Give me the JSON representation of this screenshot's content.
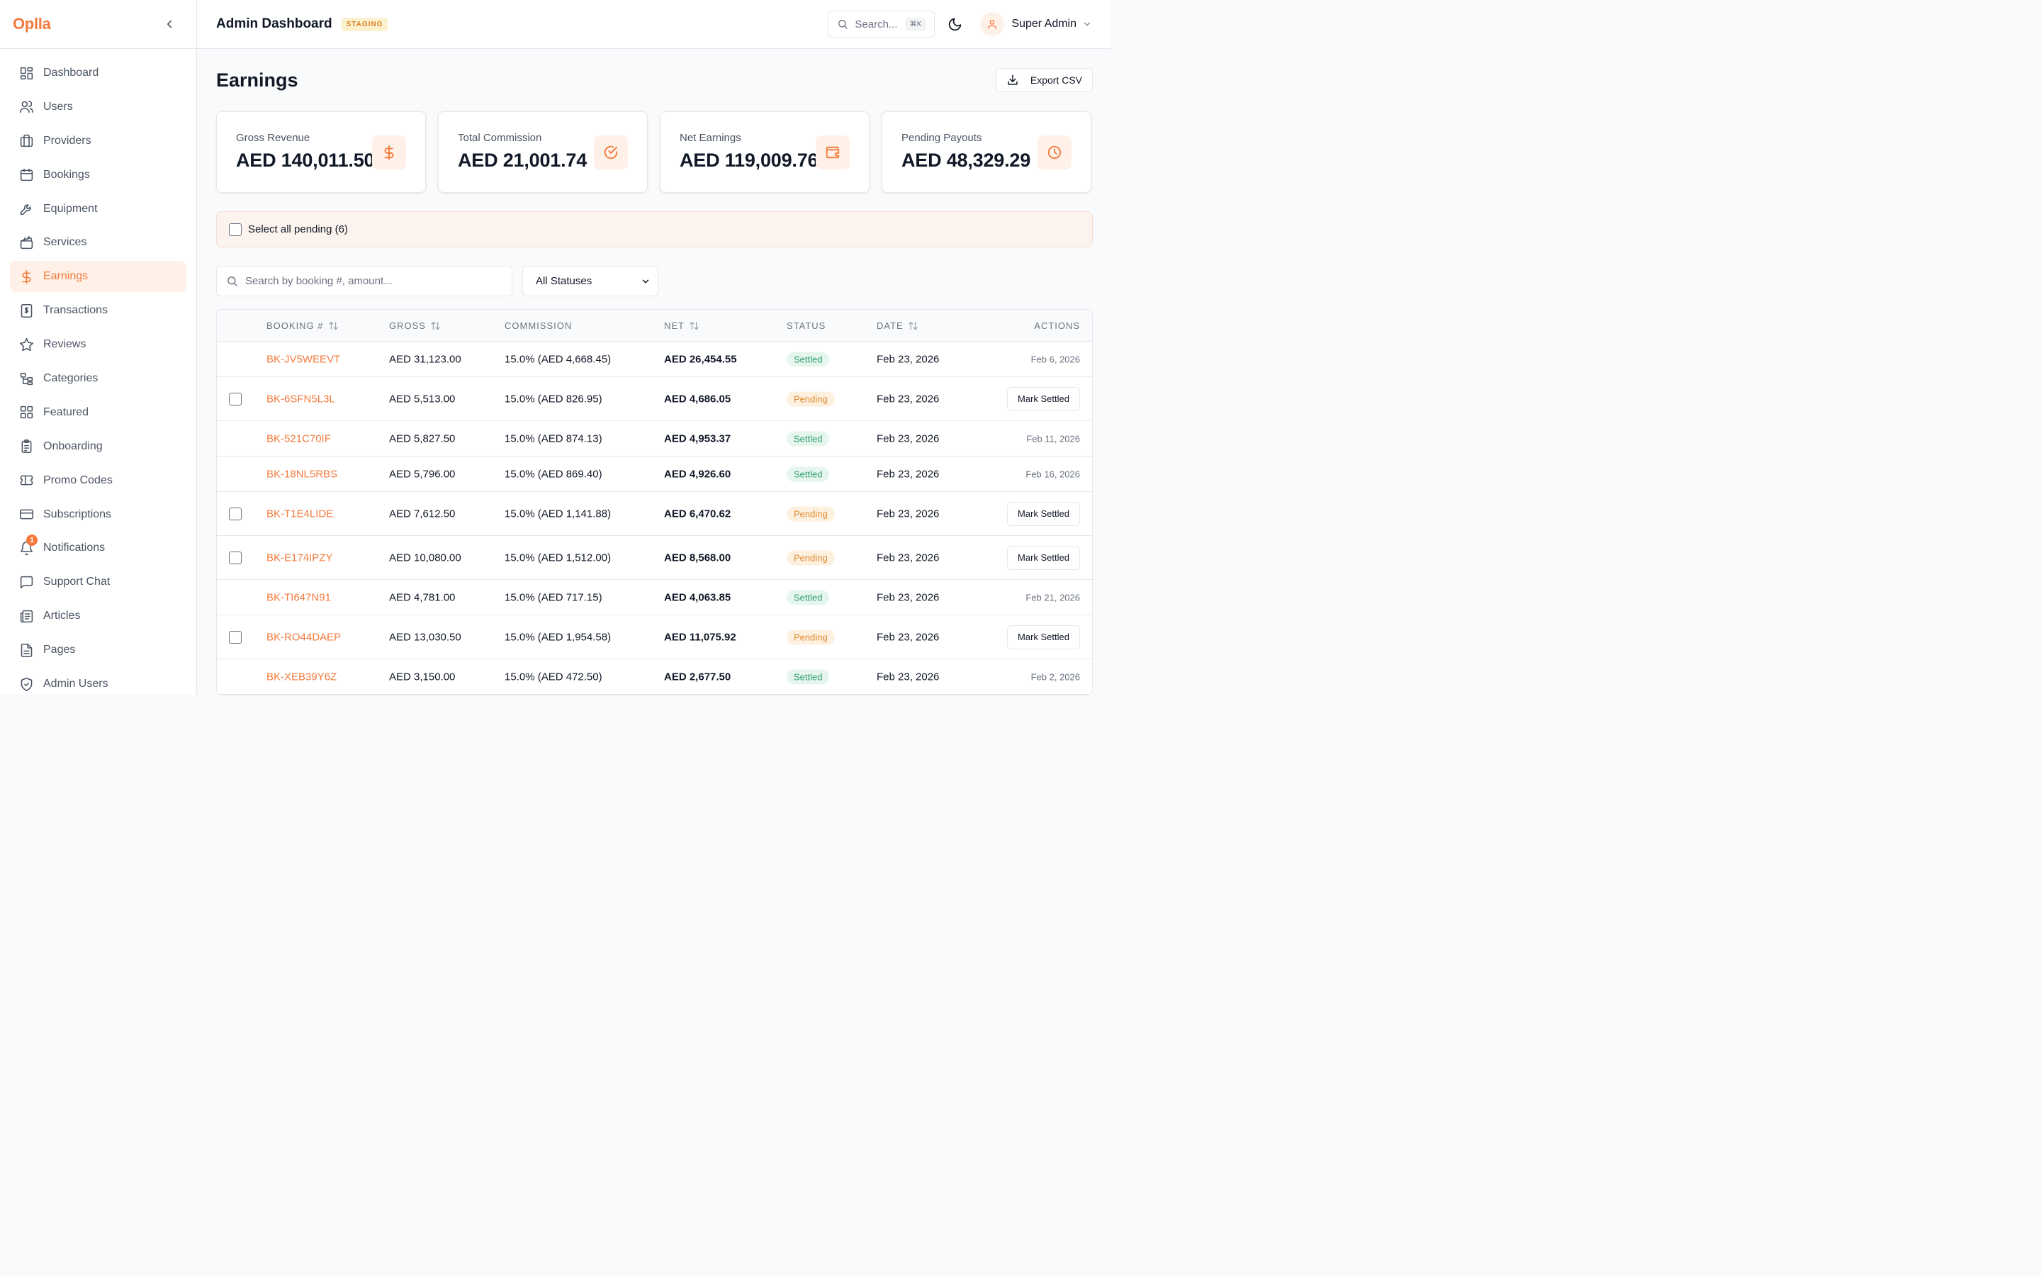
{
  "brand": "Oplla",
  "sidebar": {
    "items": [
      {
        "label": "Dashboard"
      },
      {
        "label": "Users"
      },
      {
        "label": "Providers"
      },
      {
        "label": "Bookings"
      },
      {
        "label": "Equipment"
      },
      {
        "label": "Services"
      },
      {
        "label": "Earnings"
      },
      {
        "label": "Transactions"
      },
      {
        "label": "Reviews"
      },
      {
        "label": "Categories"
      },
      {
        "label": "Featured"
      },
      {
        "label": "Onboarding"
      },
      {
        "label": "Promo Codes"
      },
      {
        "label": "Subscriptions"
      },
      {
        "label": "Notifications",
        "badge": "1"
      },
      {
        "label": "Support Chat"
      },
      {
        "label": "Articles"
      },
      {
        "label": "Pages"
      },
      {
        "label": "Admin Users"
      }
    ],
    "active": "Earnings"
  },
  "header": {
    "title": "Admin Dashboard",
    "env_badge": "STAGING",
    "search_placeholder": "Search...",
    "search_shortcut": "⌘K",
    "user_name": "Super Admin"
  },
  "page": {
    "title": "Earnings",
    "export_label": "Export CSV"
  },
  "stats": [
    {
      "label": "Gross Revenue",
      "value": "AED 140,011.50",
      "icon": "dollar-icon"
    },
    {
      "label": "Total Commission",
      "value": "AED 21,001.74",
      "icon": "check-circle-icon"
    },
    {
      "label": "Net Earnings",
      "value": "AED 119,009.76",
      "icon": "wallet-icon"
    },
    {
      "label": "Pending Payouts",
      "value": "AED 48,329.29",
      "icon": "clock-icon"
    }
  ],
  "select_all": "Select all pending (6)",
  "filters": {
    "search_placeholder": "Search by booking #, amount...",
    "status_selected": "All Statuses"
  },
  "table": {
    "columns": {
      "booking": "BOOKING #",
      "gross": "GROSS",
      "commission": "COMMISSION",
      "net": "NET",
      "status": "STATUS",
      "date": "DATE",
      "actions": "ACTIONS"
    },
    "mark_settled_label": "Mark Settled",
    "rows": [
      {
        "booking": "BK-JV5WEEVT",
        "gross": "AED 31,123.00",
        "commission": "15.0% (AED 4,668.45)",
        "net": "AED 26,454.55",
        "status": "Settled",
        "date": "Feb 23, 2026",
        "settled_date": "Feb 6, 2026"
      },
      {
        "booking": "BK-6SFN5L3L",
        "gross": "AED 5,513.00",
        "commission": "15.0% (AED 826.95)",
        "net": "AED 4,686.05",
        "status": "Pending",
        "date": "Feb 23, 2026"
      },
      {
        "booking": "BK-521C70IF",
        "gross": "AED 5,827.50",
        "commission": "15.0% (AED 874.13)",
        "net": "AED 4,953.37",
        "status": "Settled",
        "date": "Feb 23, 2026",
        "settled_date": "Feb 11, 2026"
      },
      {
        "booking": "BK-18NL5RBS",
        "gross": "AED 5,796.00",
        "commission": "15.0% (AED 869.40)",
        "net": "AED 4,926.60",
        "status": "Settled",
        "date": "Feb 23, 2026",
        "settled_date": "Feb 16, 2026"
      },
      {
        "booking": "BK-T1E4LIDE",
        "gross": "AED 7,612.50",
        "commission": "15.0% (AED 1,141.88)",
        "net": "AED 6,470.62",
        "status": "Pending",
        "date": "Feb 23, 2026"
      },
      {
        "booking": "BK-E174IPZY",
        "gross": "AED 10,080.00",
        "commission": "15.0% (AED 1,512.00)",
        "net": "AED 8,568.00",
        "status": "Pending",
        "date": "Feb 23, 2026"
      },
      {
        "booking": "BK-TI647N91",
        "gross": "AED 4,781.00",
        "commission": "15.0% (AED 717.15)",
        "net": "AED 4,063.85",
        "status": "Settled",
        "date": "Feb 23, 2026",
        "settled_date": "Feb 21, 2026"
      },
      {
        "booking": "BK-RO44DAEP",
        "gross": "AED 13,030.50",
        "commission": "15.0% (AED 1,954.58)",
        "net": "AED 11,075.92",
        "status": "Pending",
        "date": "Feb 23, 2026"
      },
      {
        "booking": "BK-XEB39Y6Z",
        "gross": "AED 3,150.00",
        "commission": "15.0% (AED 472.50)",
        "net": "AED 2,677.50",
        "status": "Settled",
        "date": "Feb 23, 2026",
        "settled_date": "Feb 2, 2026"
      }
    ]
  },
  "colors": {
    "accent": "#f47a3c",
    "settled": "#2f9e6b",
    "pending": "#e08a2e"
  }
}
